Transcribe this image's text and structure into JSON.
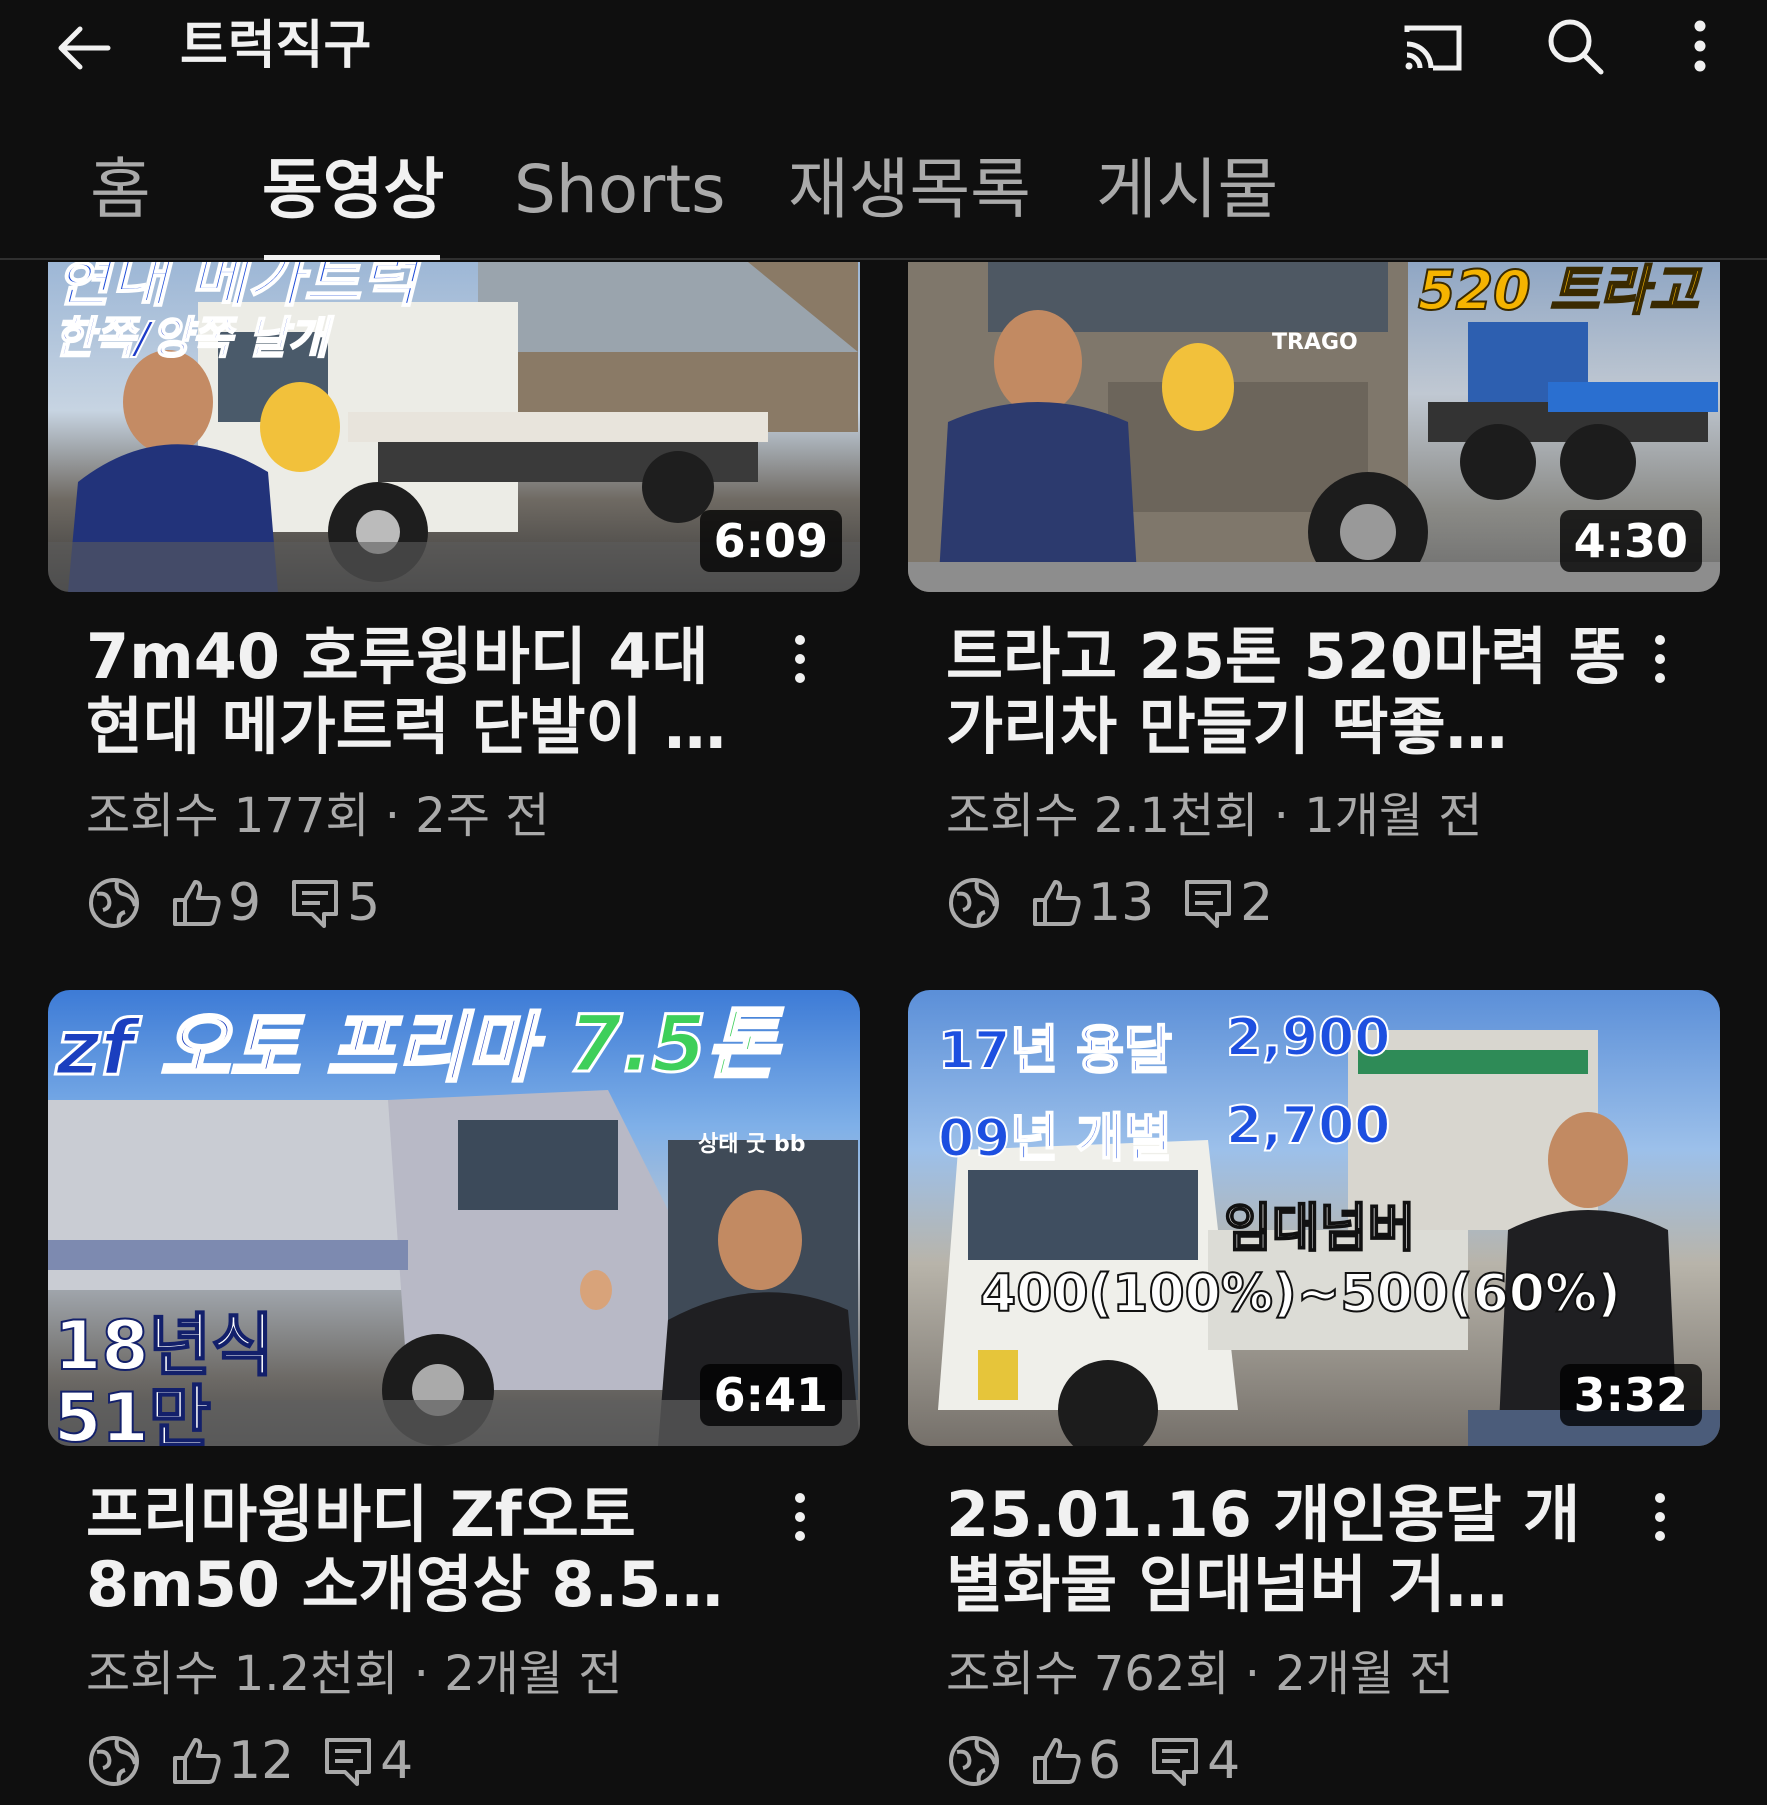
{
  "header": {
    "channel_title": "트럭직구"
  },
  "tabs": [
    {
      "label": "홈"
    },
    {
      "label": "동영상"
    },
    {
      "label": "Shorts"
    },
    {
      "label": "재생목록"
    },
    {
      "label": "게시물"
    }
  ],
  "videos": [
    {
      "title": "7m40 호루윙바디 4대 현대 메가트럭 단발이 …",
      "views": "조회수 177회",
      "age": "2주 전",
      "duration": "6:09",
      "likes": "9",
      "comments": "5",
      "thumb_text_1": "한쪽/양쪽 날개",
      "thumb_text_2": "현대 메가트럭"
    },
    {
      "title": "트라고 25톤 520마력 똥가리차 만들기 딱좋…",
      "views": "조회수 2.1천회",
      "age": "1개월 전",
      "duration": "4:30",
      "likes": "13",
      "comments": "2",
      "thumb_text_1": "520 트라고",
      "thumb_text_2": "TRAGO"
    },
    {
      "title": "프리마윙바디 Zf오토 8m50 소개영상 8.5…",
      "views": "조회수 1.2천회",
      "age": "2개월 전",
      "duration": "6:41",
      "likes": "12",
      "comments": "4",
      "thumb_text_1": "zf 오토 프리마",
      "thumb_text_2": "7.5톤",
      "thumb_text_3": "18년식",
      "thumb_text_4": "51만",
      "thumb_text_5": "상태 굿 bb"
    },
    {
      "title": "25.01.16 개인용달 개별화물 임대넘버 거…",
      "views": "조회수 762회",
      "age": "2개월 전",
      "duration": "3:32",
      "likes": "6",
      "comments": "4",
      "thumb_text_1": "17년 용달",
      "thumb_text_2": "2,900",
      "thumb_text_3": "09년 개별",
      "thumb_text_4": "2,700",
      "thumb_text_5": "임대넘버",
      "thumb_text_6": "400(100%)~500(60%)"
    }
  ],
  "separator": "·",
  "colors": {
    "background": "#0f0f0f",
    "text_primary": "#f1f1f1",
    "text_secondary": "#aaaaaa"
  }
}
